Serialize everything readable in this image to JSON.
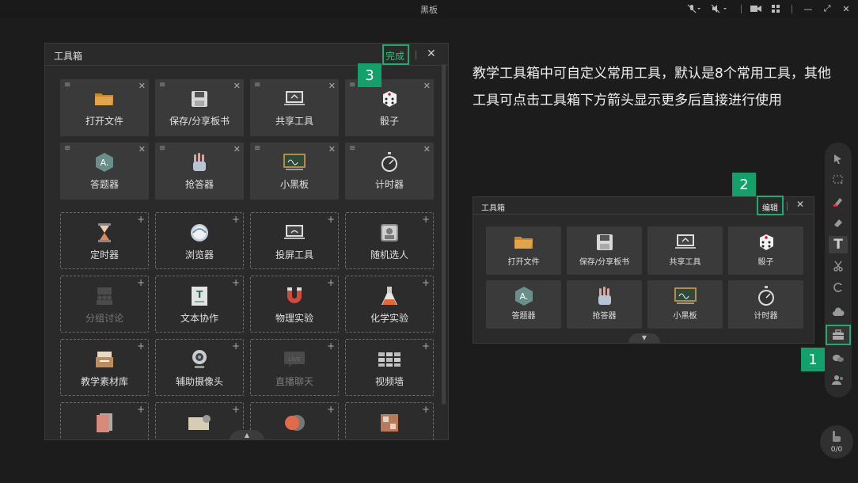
{
  "window": {
    "title": "黑板"
  },
  "topbar": {
    "mic_icon": "mic-off-icon",
    "speaker_icon": "speaker-off-icon",
    "camera_icon": "camera-icon",
    "layout_icon": "layout-grid-icon",
    "minimize": "—",
    "restore": "⤢",
    "close": "✕"
  },
  "big_panel": {
    "title": "工具箱",
    "done_label": "完成",
    "close": "✕",
    "common_tools": [
      {
        "label": "打开文件",
        "icon": "folder-icon"
      },
      {
        "label": "保存/分享板书",
        "icon": "save-icon"
      },
      {
        "label": "共享工具",
        "icon": "share-screen-icon"
      },
      {
        "label": "骰子",
        "icon": "dice-icon"
      },
      {
        "label": "答题器",
        "icon": "answer-icon"
      },
      {
        "label": "抢答器",
        "icon": "raise-hand-icon"
      },
      {
        "label": "小黑板",
        "icon": "mini-blackboard-icon"
      },
      {
        "label": "计时器",
        "icon": "stopwatch-icon"
      }
    ],
    "more_tools": [
      {
        "label": "定时器",
        "icon": "hourglass-icon",
        "disabled": false
      },
      {
        "label": "浏览器",
        "icon": "browser-icon",
        "disabled": false
      },
      {
        "label": "投屏工具",
        "icon": "cast-screen-icon",
        "disabled": false
      },
      {
        "label": "随机选人",
        "icon": "random-pick-icon",
        "disabled": false
      },
      {
        "label": "分组讨论",
        "icon": "group-discuss-icon",
        "disabled": true
      },
      {
        "label": "文本协作",
        "icon": "text-collab-icon",
        "disabled": false
      },
      {
        "label": "物理实验",
        "icon": "magnet-icon",
        "disabled": false
      },
      {
        "label": "化学实验",
        "icon": "flask-icon",
        "disabled": false
      },
      {
        "label": "教学素材库",
        "icon": "material-library-icon",
        "disabled": false
      },
      {
        "label": "辅助摄像头",
        "icon": "webcam-icon",
        "disabled": false
      },
      {
        "label": "直播聊天",
        "icon": "live-chat-icon",
        "disabled": true
      },
      {
        "label": "视频墙",
        "icon": "video-wall-icon",
        "disabled": false
      }
    ],
    "partial_row_icons": [
      "document-icon",
      "classic-icon",
      "record-icon",
      "gallery-icon"
    ]
  },
  "description": {
    "text": "教学工具箱中可自定义常用工具，默认是8个常用工具，其他工具可点击工具箱下方箭头显示更多后直接进行使用"
  },
  "small_panel": {
    "title": "工具箱",
    "edit_label": "编辑",
    "close": "✕",
    "tools": [
      {
        "label": "打开文件",
        "icon": "folder-icon"
      },
      {
        "label": "保存/分享板书",
        "icon": "save-icon"
      },
      {
        "label": "共享工具",
        "icon": "share-screen-icon"
      },
      {
        "label": "骰子",
        "icon": "dice-icon"
      },
      {
        "label": "答题器",
        "icon": "answer-icon"
      },
      {
        "label": "抢答器",
        "icon": "raise-hand-icon"
      },
      {
        "label": "小黑板",
        "icon": "mini-blackboard-icon"
      },
      {
        "label": "计时器",
        "icon": "stopwatch-icon"
      }
    ]
  },
  "callouts": {
    "one": "1",
    "two": "2",
    "three": "3"
  },
  "side_toolbar": {
    "items": [
      "select-pointer-icon",
      "area-select-icon",
      "pen-icon",
      "eraser-icon",
      "text-icon",
      "scissors-icon",
      "shape-icon",
      "cloud-icon",
      "toolbox-icon",
      "chat-icon",
      "users-icon"
    ],
    "text_glyph": "T"
  },
  "counter": {
    "value": "0/0",
    "icon": "raise-hand-counter-icon"
  }
}
